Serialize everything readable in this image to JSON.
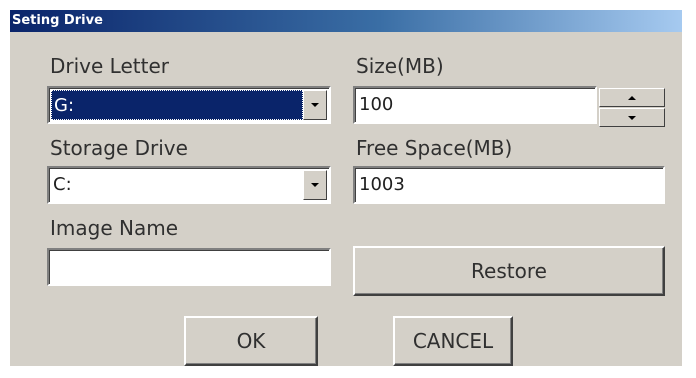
{
  "window": {
    "title": "Seting Drive"
  },
  "drive_letter": {
    "label": "Drive Letter",
    "value": "G:"
  },
  "size": {
    "label": "Size(MB)",
    "value": "100"
  },
  "storage_drive": {
    "label": "Storage Drive",
    "value": "C:"
  },
  "free_space": {
    "label": "Free Space(MB)",
    "value": "1003"
  },
  "image_name": {
    "label": "Image Name",
    "value": ""
  },
  "buttons": {
    "restore": "Restore",
    "ok": "OK",
    "cancel": "CANCEL"
  },
  "icons": {
    "combo_dropdown": "chevron-down-icon",
    "spin_up": "triangle-up-icon",
    "spin_down": "triangle-down-icon"
  },
  "colors": {
    "titlebar_start": "#0a246a",
    "titlebar_end": "#a6caf0",
    "dialog_bg": "#d4d0c8",
    "selection_bg": "#0a246a"
  }
}
